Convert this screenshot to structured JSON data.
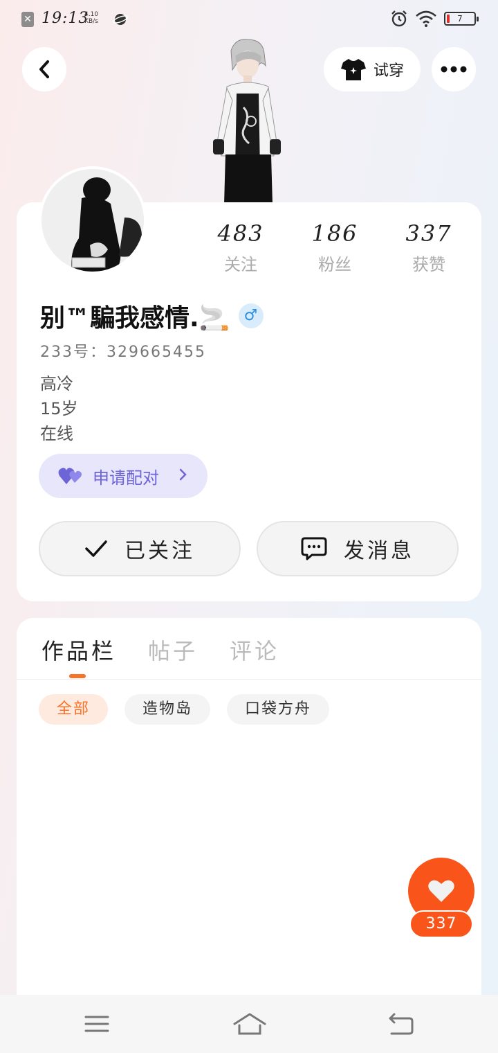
{
  "status_bar": {
    "time": "19:13",
    "speed_value": "4.10",
    "speed_unit": "KB/s",
    "battery": "7"
  },
  "header": {
    "try_on_label": "试穿"
  },
  "profile": {
    "stats": [
      {
        "value": "483",
        "label": "关注"
      },
      {
        "value": "186",
        "label": "粉丝"
      },
      {
        "value": "337",
        "label": "获赞"
      }
    ],
    "name": "别™騙我感情.🚬",
    "gender_symbol": "♂",
    "uid": "233号：329665455",
    "bio": [
      "高冷",
      "15岁",
      "在线"
    ],
    "pair_label": "申请配对",
    "follow_label": "已关注",
    "message_label": "发消息"
  },
  "works": {
    "tabs": [
      "作品栏",
      "帖子",
      "评论"
    ],
    "chips": [
      "全部",
      "造物岛",
      "口袋方舟"
    ]
  },
  "like_count": "337",
  "colors": {
    "accent_orange": "#f7722a",
    "like_red": "#f9541a",
    "pair_purple": "#6d64d8",
    "gender_blue": "#2c8fe6"
  }
}
